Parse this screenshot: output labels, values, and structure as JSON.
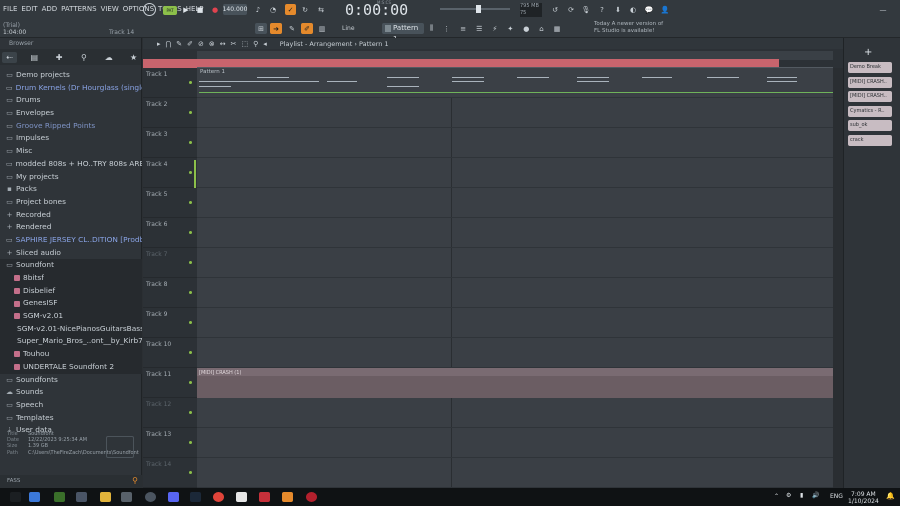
{
  "menu": [
    "FILE",
    "EDIT",
    "ADD",
    "PATTERNS",
    "VIEW",
    "OPTIONS",
    "TOOLS",
    "HELP"
  ],
  "info": {
    "line1": "(Trial)",
    "line2": "1:04:00",
    "track": "Track 14"
  },
  "transport": {
    "tempo": "140.000",
    "pat_label": "PAT",
    "time": "0:00:00",
    "time_label": "M:S:CS",
    "pattern": "Pattern 1",
    "snap": "Line",
    "mem": "795 MB",
    "cpu": "75"
  },
  "news": {
    "line1": "Today  A newer version of",
    "line2": "FL Studio is available!"
  },
  "browser": {
    "title": "Browser",
    "items": [
      {
        "label": "Demo projects",
        "icon": "folder",
        "style": "normal"
      },
      {
        "label": "Drum Kernels (Dr Hourglass (single drum machine))",
        "icon": "folder",
        "style": "hl"
      },
      {
        "label": "Drums",
        "icon": "folder",
        "style": "normal"
      },
      {
        "label": "Envelopes",
        "icon": "folder",
        "style": "normal"
      },
      {
        "label": "Groove Ripped Points",
        "icon": "folder",
        "style": "dim"
      },
      {
        "label": "Impulses",
        "icon": "folder",
        "style": "normal"
      },
      {
        "label": "Misc",
        "icon": "folder",
        "style": "normal"
      },
      {
        "label": "modded 808s + HO..TRY 808s ARE MIXED",
        "icon": "folder",
        "style": "normal"
      },
      {
        "label": "My projects",
        "icon": "folder",
        "style": "normal"
      },
      {
        "label": "Packs",
        "icon": "pack",
        "style": "normal"
      },
      {
        "label": "Project bones",
        "icon": "folder",
        "style": "normal"
      },
      {
        "label": "Recorded",
        "icon": "plus",
        "style": "normal"
      },
      {
        "label": "Rendered",
        "icon": "plus",
        "style": "normal"
      },
      {
        "label": "SAPHIRE JERSEY CL..DITION [Prodbymed]",
        "icon": "folder",
        "style": "hl"
      },
      {
        "label": "Sliced audio",
        "icon": "plus",
        "style": "normal"
      },
      {
        "label": "Soundfont",
        "icon": "folder",
        "style": "open"
      },
      {
        "label": "8bitsf",
        "icon": "sf",
        "style": "sub"
      },
      {
        "label": "Disbelief",
        "icon": "sf",
        "style": "sub"
      },
      {
        "label": "GenesISF",
        "icon": "sf",
        "style": "sub"
      },
      {
        "label": "SGM-v2.01",
        "icon": "sf",
        "style": "sub"
      },
      {
        "label": "SGM-v2.01-NicePianosGuitarsBass-V1.2",
        "icon": "sf",
        "style": "sub"
      },
      {
        "label": "Super_Mario_Bros_..ont__by_Kirb7890_",
        "icon": "sf",
        "style": "sub"
      },
      {
        "label": "Touhou",
        "icon": "sf",
        "style": "sub"
      },
      {
        "label": "UNDERTALE Soundfont 2",
        "icon": "sf",
        "style": "sub"
      },
      {
        "label": "Soundfonts",
        "icon": "folder",
        "style": "normal"
      },
      {
        "label": "Sounds",
        "icon": "cloud",
        "style": "normal"
      },
      {
        "label": "Speech",
        "icon": "folder",
        "style": "normal"
      },
      {
        "label": "Templates",
        "icon": "folder",
        "style": "normal"
      },
      {
        "label": "User data",
        "icon": "down",
        "style": "normal"
      }
    ],
    "fileinfo": {
      "title_key": "Title",
      "title": "Soundfont",
      "date_key": "Date",
      "date": "12/22/2023 9:25:34 AM",
      "size_key": "Size",
      "size": "1.39 GB",
      "path_key": "Path",
      "path": "C:\\Users\\TheFireZach\\Documents\\Soundfont"
    },
    "footer": "FASS"
  },
  "playlist": {
    "title": "Playlist - Arrangement › Pattern 1",
    "tracks": [
      {
        "label": "Track 1",
        "muted": false
      },
      {
        "label": "Track 2",
        "muted": false
      },
      {
        "label": "Track 3",
        "muted": false
      },
      {
        "label": "Track 4",
        "muted": false
      },
      {
        "label": "Track 5",
        "muted": false
      },
      {
        "label": "Track 6",
        "muted": false
      },
      {
        "label": "Track 7",
        "muted": true
      },
      {
        "label": "Track 8",
        "muted": false
      },
      {
        "label": "Track 9",
        "muted": false
      },
      {
        "label": "Track 10",
        "muted": false
      },
      {
        "label": "Track 11",
        "muted": false
      },
      {
        "label": "Track 12",
        "muted": true
      },
      {
        "label": "Track 13",
        "muted": false
      },
      {
        "label": "Track 14",
        "muted": true
      }
    ],
    "clip1": "Pattern 1",
    "clip11": "[MIDI] CRASH (1)"
  },
  "rack": {
    "items": [
      "Demo Break",
      "[MIDI] CRASH..",
      "[MIDI] CRASH..",
      "Cymatics - R..",
      "sub_ok",
      "crack"
    ]
  },
  "taskbar": {
    "lang": "ENG",
    "time": "7:09 AM",
    "date": "1/10/2024"
  }
}
